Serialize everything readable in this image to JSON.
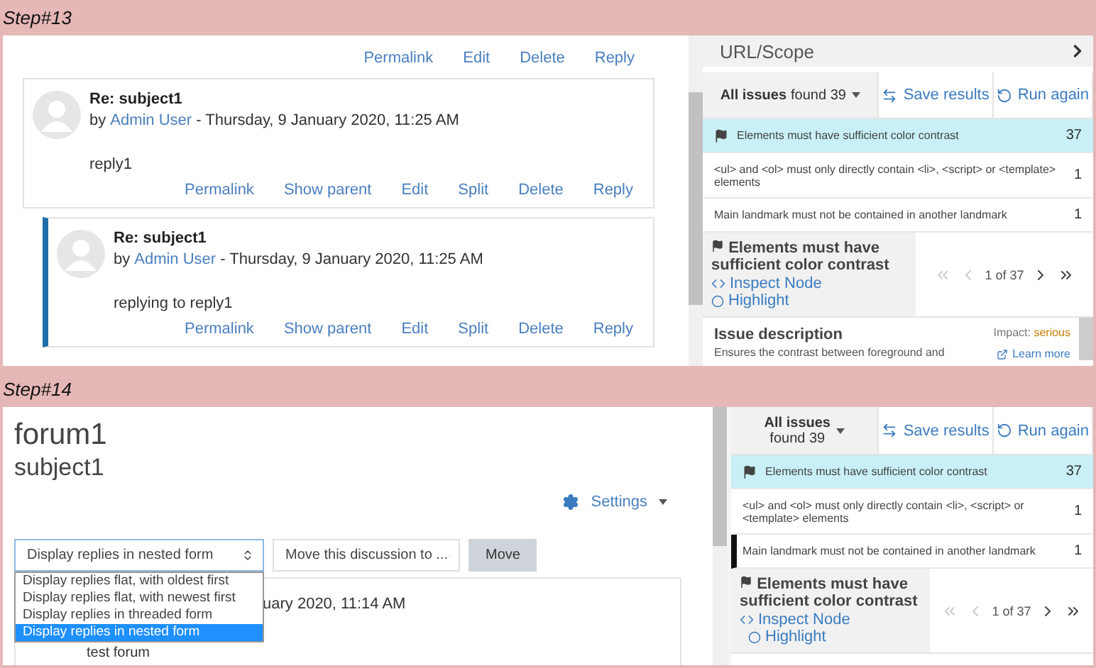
{
  "step_13": {
    "label": "Step#13",
    "forum": {
      "top_actions": [
        "Permalink",
        "Edit",
        "Delete",
        "Reply"
      ],
      "posts": [
        {
          "title": "Re: subject1",
          "by": "by",
          "author": "Admin User",
          "date": "- Thursday, 9 January 2020, 11:25 AM",
          "body": "reply1",
          "actions": [
            "Permalink",
            "Show parent",
            "Edit",
            "Split",
            "Delete",
            "Reply"
          ],
          "nested": false
        },
        {
          "title": "Re: subject1",
          "by": "by",
          "author": "Admin User",
          "date": "- Thursday, 9 January 2020, 11:25 AM",
          "body": "replying to reply1",
          "actions": [
            "Permalink",
            "Show parent",
            "Edit",
            "Split",
            "Delete",
            "Reply"
          ],
          "nested": true
        }
      ]
    },
    "axe": {
      "scope": "URL/Scope",
      "filter": {
        "label": "All issues",
        "count": "found 39"
      },
      "save": "Save results",
      "run": "Run again",
      "issues": [
        {
          "text": "Elements must have sufficient color contrast",
          "count": "37",
          "selected": true,
          "focused": false
        },
        {
          "text": "<ul> and <ol> must only directly contain <li>, <script> or <template> elements",
          "count": "1",
          "selected": false,
          "focused": false
        },
        {
          "text": "Main landmark must not be contained in another landmark",
          "count": "1",
          "selected": false,
          "focused": false
        }
      ],
      "detail": {
        "title": "Elements must have sufficient color contrast",
        "inspect": "Inspect Node",
        "highlight": "Highlight",
        "pager": "1 of 37",
        "prev_disabled": true,
        "next_disabled": false
      },
      "description": {
        "heading": "Issue description",
        "text": "Ensures the contrast between foreground and",
        "impact_label": "Impact:",
        "impact": "serious",
        "learn_more": "Learn more"
      }
    }
  },
  "step_14": {
    "label": "Step#14",
    "forum": {
      "title": "forum1",
      "subject": "subject1",
      "settings": "Settings",
      "display_select": "Display replies in nested form",
      "move_select": "Move this discussion to ...",
      "move_button": "Move",
      "display_options": [
        {
          "label": "Display replies flat, with oldest first",
          "selected": false
        },
        {
          "label": "Display replies flat, with newest first",
          "selected": false
        },
        {
          "label": "Display replies in threaded form",
          "selected": false
        },
        {
          "label": "Display replies in nested form",
          "selected": true
        }
      ],
      "post_date": "uary 2020, 11:14 AM",
      "post_body": "test forum"
    },
    "axe": {
      "filter": {
        "label": "All issues",
        "count": "found 39"
      },
      "save": "Save results",
      "run": "Run again",
      "issues": [
        {
          "text": "Elements must have sufficient color contrast",
          "count": "37",
          "selected": true,
          "focused": false
        },
        {
          "text": "<ul> and <ol> must only directly contain <li>, <script> or <template> elements",
          "count": "1",
          "selected": false,
          "focused": false
        },
        {
          "text": "Main landmark must not be contained in another landmark",
          "count": "1",
          "selected": false,
          "focused": true
        }
      ],
      "detail": {
        "title": "Elements must have sufficient color contrast",
        "inspect": "Inspect Node",
        "highlight": "Highlight",
        "pager": "1 of 37",
        "prev_disabled": true,
        "next_disabled": false
      }
    }
  }
}
